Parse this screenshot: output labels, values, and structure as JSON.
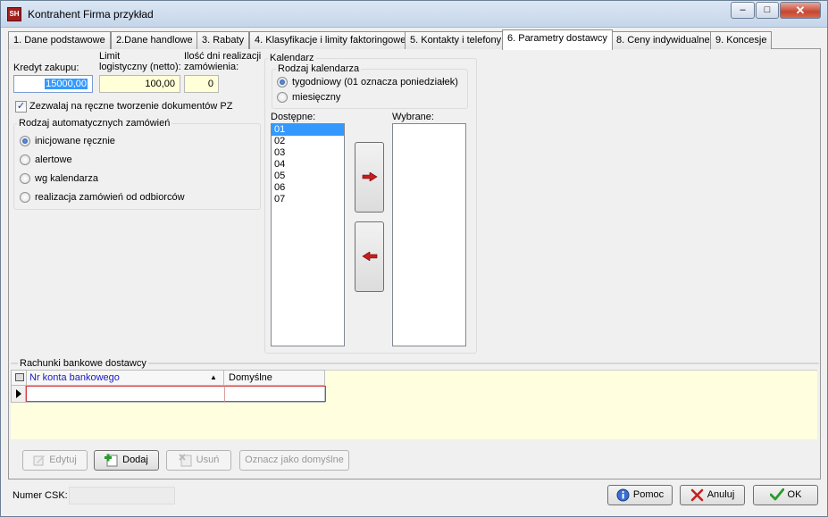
{
  "window": {
    "title": "Kontrahent Firma przykład",
    "app_icon": "SH",
    "minimize": "–",
    "maximize": "□",
    "close": "✕"
  },
  "tabs": [
    {
      "label": "1. Dane podstawowe"
    },
    {
      "label": "2.Dane handlowe"
    },
    {
      "label": "3. Rabaty"
    },
    {
      "label": "4. Klasyfikacje i limity faktoringowe"
    },
    {
      "label": "5. Kontakty i telefony"
    },
    {
      "label": "6. Parametry dostawcy",
      "active": true
    },
    {
      "label": "8. Ceny indywidualne"
    },
    {
      "label": "9. Koncesje"
    }
  ],
  "fields": {
    "kredyt_label": "Kredyt zakupu:",
    "kredyt_value": "15000,00",
    "limit_label_1": "Limit",
    "limit_label_2": "logistyczny (netto):",
    "limit_value": "100,00",
    "ilosc_label_1": "Ilość dni realizacji",
    "ilosc_label_2": "zamówienia:",
    "ilosc_value": "0"
  },
  "allow_manual_pz": {
    "label": "Zezwalaj na ręczne tworzenie dokumentów PZ",
    "checked": true
  },
  "order_type": {
    "title": "Rodzaj automatycznych zamówień",
    "options": [
      {
        "label": "inicjowane ręcznie",
        "selected": true
      },
      {
        "label": "alertowe"
      },
      {
        "label": "wg kalendarza"
      },
      {
        "label": "realizacja zamówień od odbiorców"
      }
    ]
  },
  "calendar": {
    "title": "Kalendarz",
    "type_title": "Rodzaj kalendarza",
    "types": [
      {
        "label": "tygodniowy (01 oznacza poniedziałek)",
        "selected": true
      },
      {
        "label": "miesięczny"
      }
    ],
    "available_label": "Dostępne:",
    "available": [
      "01",
      "02",
      "03",
      "04",
      "05",
      "06",
      "07"
    ],
    "selected_label": "Wybrane:",
    "selected": []
  },
  "bank": {
    "title": "Rachunki bankowe dostawcy",
    "columns": [
      "Nr konta bankowego",
      "Domyślne"
    ],
    "sort_indicator": "▲",
    "buttons": {
      "edit": "Edytuj",
      "add": "Dodaj",
      "remove": "Usuń",
      "default": "Oznacz jako domyślne"
    }
  },
  "footer": {
    "csk_label": "Numer CSK:",
    "csk_value": "",
    "help": "Pomoc",
    "cancel": "Anuluj",
    "ok": "OK"
  },
  "colors": {
    "selection": "#3399ff",
    "input_yellow": "#ffffd8",
    "grid_yellow": "#ffffe0",
    "error_red": "#d04040"
  }
}
